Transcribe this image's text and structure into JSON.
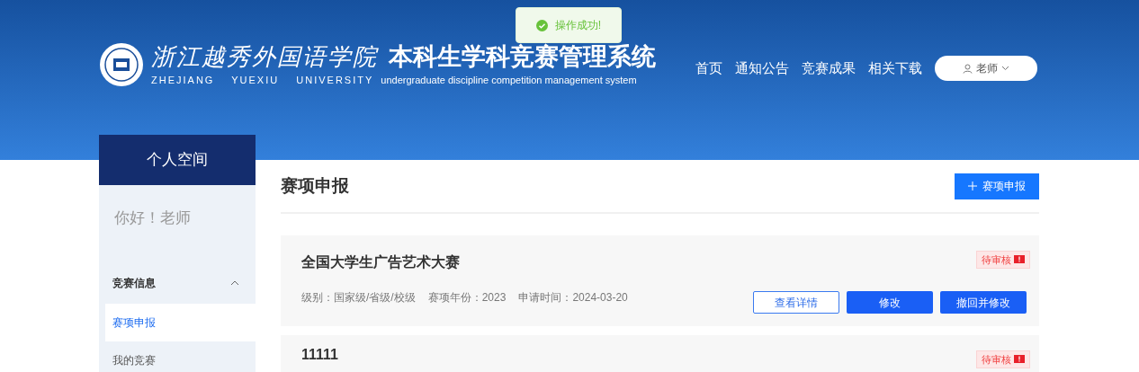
{
  "toast": {
    "text": "操作成功!"
  },
  "header": {
    "school_name_cn": "浙江越秀外国语学院",
    "school_name_en": "ZHEJIANG YUEXIU UNIVERSITY",
    "system_name_cn": "本科生学科竞赛管理系统",
    "system_name_en": "undergraduate discipline competition management system"
  },
  "nav": [
    {
      "label": "首页"
    },
    {
      "label": "通知公告"
    },
    {
      "label": "竞赛成果"
    },
    {
      "label": "相关下载"
    }
  ],
  "user_menu": {
    "label": "老师"
  },
  "sidebar": {
    "title": "个人空间",
    "greeting": "你好！老师",
    "groups": [
      {
        "label": "竞赛信息",
        "expanded": true,
        "items": [
          {
            "label": "赛项申报",
            "selected": true
          },
          {
            "label": "我的竞赛",
            "selected": false
          }
        ]
      }
    ]
  },
  "main": {
    "title": "赛项申报",
    "add_button": "赛项申报",
    "cards": [
      {
        "title": "全国大学生广告艺术大赛",
        "status": "待审核",
        "meta": [
          "级别：国家级/省级/校级",
          "赛项年份：2023",
          "申请时间：2024-03-20"
        ],
        "buttons": [
          {
            "label": "查看详情",
            "kind": "outline"
          },
          {
            "label": "修改",
            "kind": "primary"
          },
          {
            "label": "撤回并修改",
            "kind": "primary"
          }
        ]
      },
      {
        "title": "11111",
        "status": "待审核"
      }
    ]
  }
}
